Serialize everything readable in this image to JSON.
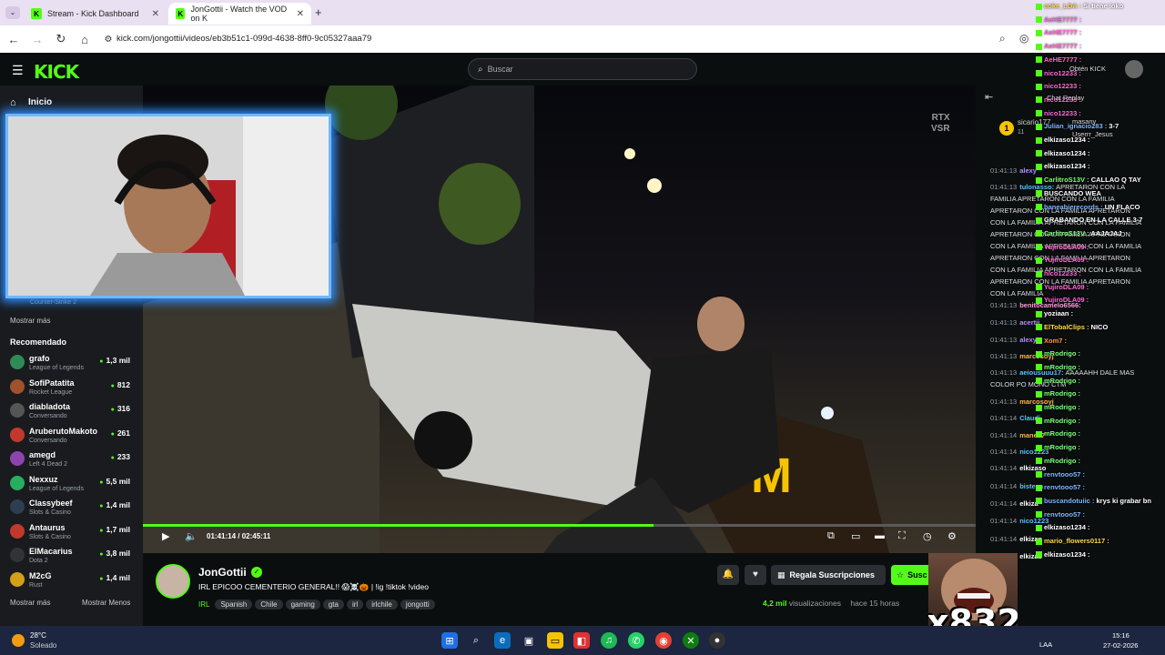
{
  "browser": {
    "tabs": [
      {
        "title": "Stream - Kick Dashboard",
        "close": "✕"
      },
      {
        "title": "JonGottii - Watch the VOD on K",
        "close": "✕"
      }
    ],
    "new_tab": "+",
    "url": "kick.com/jongottii/videos/eb3b51c1-099d-4638-8ff0-9c05327aaa79"
  },
  "header": {
    "logo": "KICK",
    "search_placeholder": "Buscar"
  },
  "sidebar": {
    "home_label": "Inicio",
    "cut_category": "Counter-Strike 2",
    "show_more_top": "Mostrar más",
    "recommended_title": "Recomendado",
    "channels": [
      {
        "name": "grafo",
        "category": "League of Legends",
        "viewers": "1,3 mil",
        "color": "#2e8b57"
      },
      {
        "name": "SofiPatatita",
        "category": "Rocket League",
        "viewers": "812",
        "color": "#a0522d"
      },
      {
        "name": "diabladota",
        "category": "Conversando",
        "viewers": "316",
        "color": "#555555"
      },
      {
        "name": "AruberutoMakoto",
        "category": "Conversando",
        "viewers": "261",
        "color": "#c0392b"
      },
      {
        "name": "amegd",
        "category": "Left 4 Dead 2",
        "viewers": "233",
        "color": "#8e44ad"
      },
      {
        "name": "Nexxuz",
        "category": "League of Legends",
        "viewers": "5,5 mil",
        "color": "#27ae60"
      },
      {
        "name": "Classybeef",
        "category": "Slots & Casino",
        "viewers": "1,4 mil",
        "color": "#2c3e50"
      },
      {
        "name": "Antaurus",
        "category": "Slots & Casino",
        "viewers": "1,7 mil",
        "color": "#c0392b"
      },
      {
        "name": "ElMacarius",
        "category": "Dota 2",
        "viewers": "3,8 mil",
        "color": "#333333"
      },
      {
        "name": "M2cG",
        "category": "Rust",
        "viewers": "1,4 mil",
        "color": "#d4a017"
      }
    ],
    "show_more": "Mostrar más",
    "show_less": "Mostrar Menos"
  },
  "video": {
    "watermark_1": "RTX",
    "watermark_2": "VSR",
    "time": "01:41:14 / 02:45:11",
    "progress_fraction": 0.613
  },
  "stream": {
    "streamer": "JonGottii",
    "title": "IRL EPICOO CEMENTERIO GENERAL!! 😱☠️🎃 | !ig !tiktok !video",
    "tags": [
      "IRL",
      "Spanish",
      "Chile",
      "gaming",
      "gta",
      "irl",
      "irlchile",
      "jongotti"
    ],
    "gift_button": "Regala Suscripciones",
    "subscribe_button": "Susc",
    "views_count": "4,2 mil",
    "views_label": "visualizaciones",
    "posted": "hace 15 horas"
  },
  "chat": {
    "pinned_user": "sicario177",
    "pinned_count": "11",
    "lines": [
      {
        "time": "01:41:13",
        "user": "alexy",
        "color": "#b48cff",
        "text": ""
      },
      {
        "time": "01:41:13",
        "user": "tulonasso:",
        "color": "#5bc0ff",
        "text": "APRETARON CON LA"
      },
      {
        "time": "",
        "user": "",
        "color": "#ffffff",
        "text": "FAMILIA APRETARON CON LA FAMILIA"
      },
      {
        "time": "",
        "user": "",
        "color": "#ffffff",
        "text": "APRETARON CON LA FAMILIA APRETARON"
      },
      {
        "time": "",
        "user": "",
        "color": "#ffffff",
        "text": "CON LA FAMILIA APRETARON CON LA FAMILIA"
      },
      {
        "time": "",
        "user": "",
        "color": "#ffffff",
        "text": "APRETARON CON LA FAMILIA APRETARON"
      },
      {
        "time": "",
        "user": "",
        "color": "#ffffff",
        "text": "CON LA FAMILIA APRETARON CON LA FAMILIA"
      },
      {
        "time": "",
        "user": "",
        "color": "#ffffff",
        "text": "APRETARON CON LA FAMILIA APRETARON"
      },
      {
        "time": "",
        "user": "",
        "color": "#ffffff",
        "text": "CON LA FAMILIA APRETARON CON LA FAMILIA"
      },
      {
        "time": "",
        "user": "",
        "color": "#ffffff",
        "text": "APRETARON CON LA FAMILIA APRETARON"
      },
      {
        "time": "",
        "user": "",
        "color": "#ffffff",
        "text": "CON LA FAMILIA"
      },
      {
        "time": "01:41:13",
        "user": "benitocamelo6566:",
        "color": "#ff9ad5",
        "text": ""
      },
      {
        "time": "01:41:13",
        "user": "acertij",
        "color": "#b48cff",
        "text": ""
      },
      {
        "time": "01:41:13",
        "user": "alexy",
        "color": "#b48cff",
        "text": ""
      },
      {
        "time": "01:41:13",
        "user": "marcosoyj",
        "color": "#ffb347",
        "text": ""
      },
      {
        "time": "01:41:13",
        "user": "aeiousuuu17:",
        "color": "#5bc0ff",
        "text": "AAAAAHH DALE MAS"
      },
      {
        "time": "",
        "user": "",
        "color": "#ffffff",
        "text": "COLOR PO MONO CTM"
      },
      {
        "time": "01:41:13",
        "user": "marcosoyj",
        "color": "#ffb347",
        "text": ""
      },
      {
        "time": "01:41:14",
        "user": "Claudi",
        "color": "#5bc0ff",
        "text": ""
      },
      {
        "time": "01:41:14",
        "user": "manes7",
        "color": "#ffb347",
        "text": ""
      },
      {
        "time": "01:41:14",
        "user": "nico1223",
        "color": "#5bc0ff",
        "text": ""
      },
      {
        "time": "01:41:14",
        "user": "elkizaso",
        "color": "#ffffff",
        "text": ""
      },
      {
        "time": "01:41:14",
        "user": "bisteca",
        "color": "#5bc0ff",
        "text": ""
      },
      {
        "time": "01:41:14",
        "user": "elkiza",
        "color": "#ffffff",
        "text": ""
      },
      {
        "time": "01:41:14",
        "user": "nico1223",
        "color": "#5bc0ff",
        "text": ""
      },
      {
        "time": "01:41:14",
        "user": "elkizas",
        "color": "#ffffff",
        "text": ""
      },
      {
        "time": "01:41:14",
        "user": "elkizas",
        "color": "#ffffff",
        "text": ""
      }
    ]
  },
  "overlay_chat": [
    {
      "user": "coke_LDA :",
      "text": "Si tiene loko",
      "color": "#ffd84a"
    },
    {
      "user": "AeHE7777 :",
      "text": "",
      "color": "#ff6ad5"
    },
    {
      "user": "AeHE7777 :",
      "text": "",
      "color": "#ff6ad5"
    },
    {
      "user": "AeHE7777 :",
      "text": "",
      "color": "#ff6ad5"
    },
    {
      "user": "AeHE7777 :",
      "text": "",
      "color": "#ff6ad5"
    },
    {
      "user": "nico12233 :",
      "text": "",
      "color": "#ff6ad5"
    },
    {
      "user": "nico12233 :",
      "text": "",
      "color": "#ff6ad5"
    },
    {
      "user": "nico12233 :",
      "text": "",
      "color": "#ff6ad5"
    },
    {
      "user": "nico12233 :",
      "text": "",
      "color": "#ff6ad5"
    },
    {
      "user": "Julian_ignacio283 :",
      "text": "3-7",
      "color": "#7db6ff"
    },
    {
      "user": "elkizaso1234 :",
      "text": "",
      "color": "#ffffff"
    },
    {
      "user": "elkizaso1234 :",
      "text": "",
      "color": "#ffffff"
    },
    {
      "user": "elkizaso1234 :",
      "text": "",
      "color": "#ffffff"
    },
    {
      "user": "CarlitroS13V :",
      "text": "CALLAO Q TAY",
      "color": "#7dff7d"
    },
    {
      "user": "",
      "text": "BUSCANDO WEA",
      "color": "#ffffff"
    },
    {
      "user": "baneabierecords :",
      "text": "UN FLACO",
      "color": "#7db6ff"
    },
    {
      "user": "",
      "text": "GRABANDO EN LA CALLE 3-7",
      "color": "#ffffff"
    },
    {
      "user": "CarlitroS13V :",
      "text": "AAJAJAJ",
      "color": "#7dff7d"
    },
    {
      "user": "YujiroDLA09 :",
      "text": "",
      "color": "#ff6ad5"
    },
    {
      "user": "YujiroDLA09 :",
      "text": "",
      "color": "#ff6ad5"
    },
    {
      "user": "nico12233 :",
      "text": "",
      "color": "#ff6ad5"
    },
    {
      "user": "YujiroDLA09 :",
      "text": "",
      "color": "#ff6ad5"
    },
    {
      "user": "YujiroDLA09 :",
      "text": "",
      "color": "#ff6ad5"
    },
    {
      "user": "yoziaan :",
      "text": "",
      "color": "#ffffff"
    },
    {
      "user": "ElTobalClips :",
      "text": "NICO",
      "color": "#ffd84a"
    },
    {
      "user": "Xom7 :",
      "text": "",
      "color": "#ff9a4a"
    },
    {
      "user": "mRodrigo :",
      "text": "",
      "color": "#7dff7d"
    },
    {
      "user": "mRodrigo :",
      "text": "",
      "color": "#7dff7d"
    },
    {
      "user": "mRodrigo :",
      "text": "",
      "color": "#7dff7d"
    },
    {
      "user": "mRodrigo :",
      "text": "",
      "color": "#7dff7d"
    },
    {
      "user": "mRodrigo :",
      "text": "",
      "color": "#7dff7d"
    },
    {
      "user": "mRodrigo :",
      "text": "",
      "color": "#7dff7d"
    },
    {
      "user": "mRodrigo :",
      "text": "",
      "color": "#7dff7d"
    },
    {
      "user": "mRodrigo :",
      "text": "",
      "color": "#7dff7d"
    },
    {
      "user": "mRodrigo :",
      "text": "",
      "color": "#7dff7d"
    },
    {
      "user": "renvtooo57 :",
      "text": "",
      "color": "#7db6ff"
    },
    {
      "user": "renvtooo57 :",
      "text": "",
      "color": "#7db6ff"
    },
    {
      "user": "buscandotuiic :",
      "text": "krys ki grabar bn",
      "color": "#7db6ff"
    },
    {
      "user": "renvtooo57 :",
      "text": "",
      "color": "#7db6ff"
    },
    {
      "user": "elkizaso1234 :",
      "text": "",
      "color": "#ffffff"
    },
    {
      "user": "mario_flowers0117 :",
      "text": "",
      "color": "#ffd84a"
    },
    {
      "user": "elkizaso1234 :",
      "text": "",
      "color": "#ffffff"
    }
  ],
  "overlay_extra": {
    "obtain_label": "Obtén KICK",
    "chat_replay": "Chat Replay",
    "user_masany": "masany",
    "user_jesus": "Userrr_Jesus"
  },
  "overlay_emote_text": "x832",
  "taskbar": {
    "temperature": "28°C",
    "weather": "Soleado",
    "lang": "LAA",
    "time": "15:16",
    "date": "27-02-2026"
  },
  "colors": {
    "accent": "#53fc18",
    "webcam_border": "#6fb8ff"
  }
}
